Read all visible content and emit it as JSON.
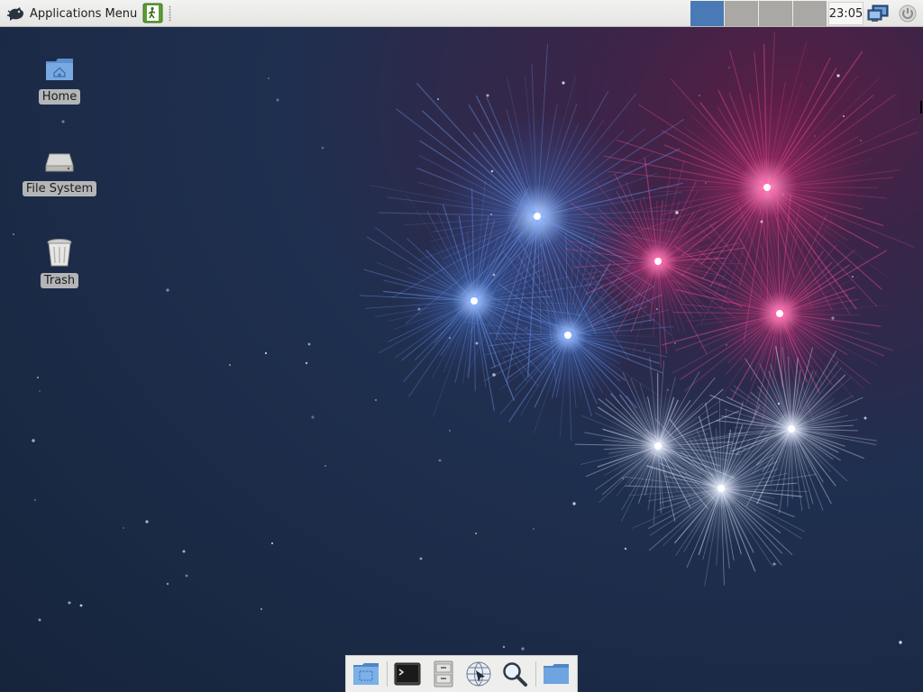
{
  "top_panel": {
    "apps_menu_label": "Applications Menu",
    "icons": {
      "apps_menu": "xfce-mouse-icon",
      "launcher": "log-out-icon",
      "network": "network-monitor-icon",
      "power": "power-icon"
    },
    "workspaces": [
      {
        "name": "workspace-1",
        "active": true
      },
      {
        "name": "workspace-2",
        "active": false
      },
      {
        "name": "workspace-3",
        "active": false
      },
      {
        "name": "workspace-4",
        "active": false
      }
    ],
    "clock": "23:05"
  },
  "desktop": {
    "icons": [
      {
        "label": "Home",
        "icon": "home-folder-icon"
      },
      {
        "label": "File System",
        "icon": "hard-drive-icon"
      },
      {
        "label": "Trash",
        "icon": "trash-icon"
      }
    ],
    "wallpaper": "fireworks"
  },
  "dock": {
    "items": [
      {
        "icon": "show-desktop-icon"
      },
      {
        "icon": "terminal-icon"
      },
      {
        "icon": "file-manager-icon"
      },
      {
        "icon": "web-browser-icon"
      },
      {
        "icon": "search-icon"
      },
      {
        "icon": "folder-icon"
      }
    ]
  },
  "colors": {
    "workspace_active": "#4a7ab5",
    "workspace_inactive": "#a9a8a4",
    "firework_blue": "#6fa2ff",
    "firework_pink": "#ff4f9a",
    "firework_white": "#e8efff"
  }
}
